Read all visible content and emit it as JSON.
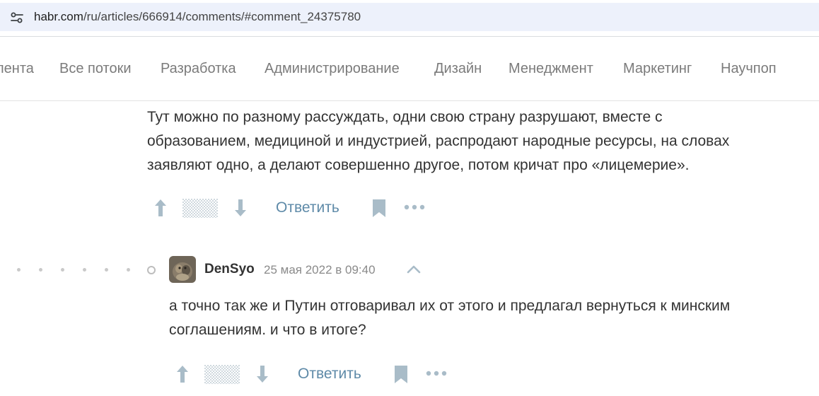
{
  "browser": {
    "url_host": "habr.com",
    "url_path": "/ru/articles/666914/comments/#comment_24375780"
  },
  "nav": {
    "items": [
      "лента",
      "Все потоки",
      "Разработка",
      "Администрирование",
      "Дизайн",
      "Менеджмент",
      "Маркетинг",
      "Научпоп"
    ]
  },
  "comments": [
    {
      "lines": [
        "Тут можно по разному рассуждать, одни свою страну разрушают, вместе с",
        "образованием, медициной и индустрией, распродают народные ресурсы, на словах",
        "заявляют одно, а делают совершенно другое, потом кричат про «лицемерие»."
      ],
      "reply_label": "Ответить"
    },
    {
      "author": "DenSyo",
      "date": "25 мая 2022 в 09:40",
      "lines": [
        "а точно так же и Путин отговаривал их от этого и предлагал вернуться к минским",
        "соглашениям. и что в итоге?"
      ],
      "reply_label": "Ответить"
    }
  ],
  "colors": {
    "accent_link": "#5e8aa8",
    "icon_grey": "#a9bcc8"
  },
  "icons": [
    "site-settings-icon",
    "upvote-icon",
    "rating-hidden-icon",
    "downvote-icon",
    "bookmark-icon",
    "more-icon",
    "collapse-up-icon"
  ]
}
